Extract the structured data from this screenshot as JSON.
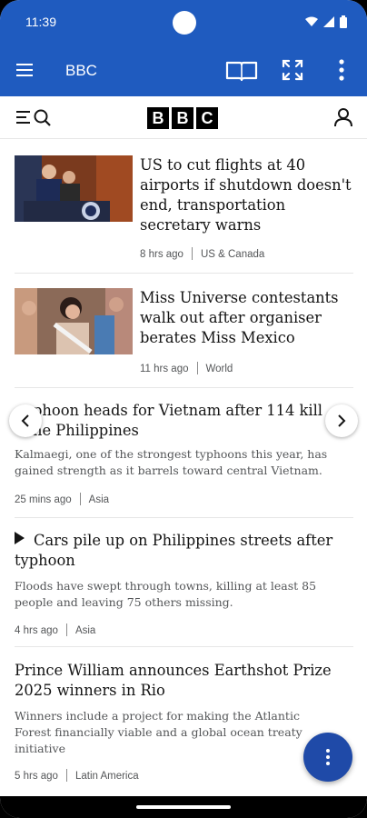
{
  "status_bar": {
    "time": "11:39"
  },
  "app_bar": {
    "title": "BBC"
  },
  "brand": {
    "logo_letters": [
      "B",
      "B",
      "C"
    ]
  },
  "colors": {
    "app_bar": "#1f5bbf",
    "fab": "#1f4aa8",
    "headline": "#141414",
    "meta": "#545658"
  },
  "icons": {
    "status": [
      "wifi-icon",
      "signal-icon",
      "battery-icon"
    ],
    "app_bar": [
      "hamburger-menu-icon",
      "book-icon",
      "fullscreen-icon",
      "more-vert-icon"
    ],
    "bbc_bar": [
      "menu-search-icon",
      "account-icon"
    ],
    "carousel": [
      "chevron-left-icon",
      "chevron-right-icon"
    ],
    "fab": "more-vert-icon",
    "video": "play-icon"
  },
  "articles": [
    {
      "headline": "US to cut flights at 40 airports if shutdown doesn't end, transportation secretary warns",
      "time": "8 hrs ago",
      "section": "US & Canada"
    },
    {
      "headline": "Miss Universe contestants walk out after organiser berates Miss Mexico",
      "time": "11 hrs ago",
      "section": "World"
    },
    {
      "headline": "Typhoon heads for Vietnam after 114 killed in the Philippines",
      "headline_visible": "phoon heads for Vietnam after 114 kill",
      "headline_visible_2": "he Philippines",
      "summary": "Kalmaegi, one of the strongest typhoons this year, has gained strength as it barrels toward central Vietnam.",
      "time": "25 mins ago",
      "section": "Asia"
    },
    {
      "headline": "Cars pile up on Philippines streets after typhoon",
      "summary": "Floods have swept through towns, killing at least 85 people and leaving 75 others missing.",
      "time": "4 hrs ago",
      "section": "Asia",
      "is_video": true
    },
    {
      "headline": "Prince William announces Earthshot Prize 2025 winners in Rio",
      "summary": "Winners include a project for making the Atlantic Forest financially viable and a global ocean treaty initiative",
      "time": "5 hrs ago",
      "section": "Latin America"
    }
  ]
}
